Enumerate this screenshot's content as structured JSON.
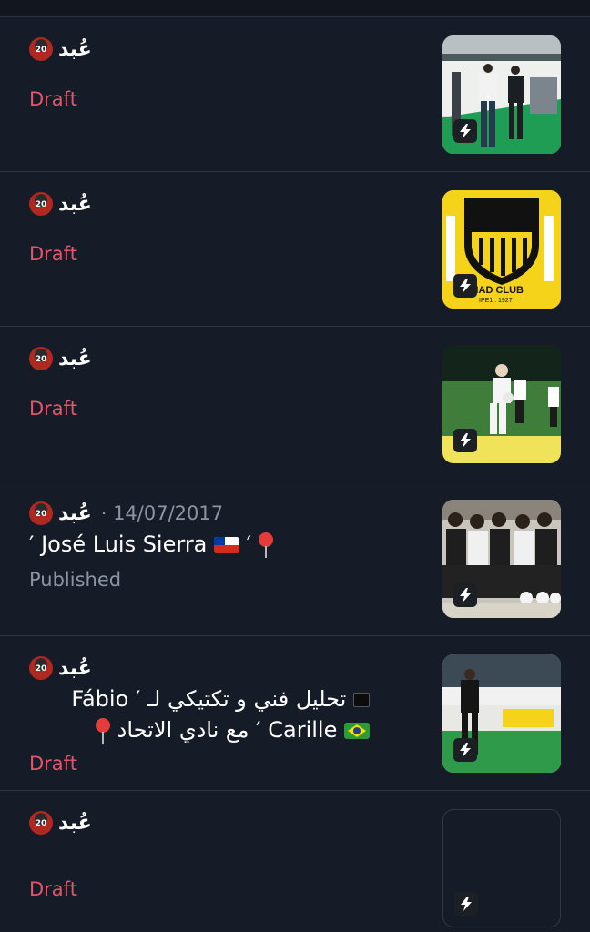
{
  "author": {
    "name": "عُبد",
    "avatar_number": "20"
  },
  "posts": [
    {
      "date": "",
      "status": "Draft",
      "text_line1": "",
      "text_line2": ""
    },
    {
      "date": "",
      "status": "Draft",
      "text_line1": "",
      "text_line2": ""
    },
    {
      "date": "",
      "status": "Draft",
      "text_line1": "",
      "text_line2": ""
    },
    {
      "date": "· 14/07/2017",
      "status": "Published",
      "text_line1": "′ José Luis Sierra",
      "text_line1_suffix": "′",
      "text_line2": ""
    },
    {
      "date": "",
      "status": "Draft",
      "text_line1": "تحليل فني و تكتيكي لـ ′ Fábio",
      "text_line2": "Carille ′ مع نادي الاتحاد"
    },
    {
      "date": "",
      "status": "Draft",
      "text_line1": "",
      "text_line2": ""
    }
  ],
  "thumbnails": {
    "badge_text": "ITTIHAD CLUB",
    "badge_year": "IPE1 . 1927"
  },
  "colors": {
    "background": "#151c27",
    "draft": "#e0566a",
    "published": "#8b95a2",
    "ittihad_yellow": "#f4d31a"
  }
}
